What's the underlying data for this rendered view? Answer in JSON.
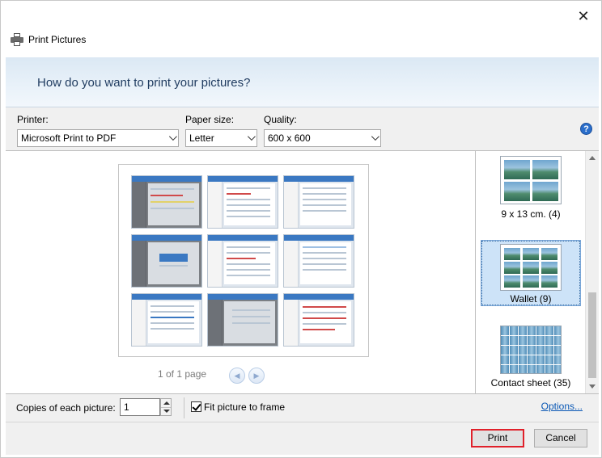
{
  "window": {
    "title": "Print Pictures",
    "close_symbol": "✕"
  },
  "banner": {
    "heading": "How do you want to print your pictures?"
  },
  "options": {
    "printer_label": "Printer:",
    "printer_value": "Microsoft Print to PDF",
    "paper_label": "Paper size:",
    "paper_value": "Letter",
    "quality_label": "Quality:",
    "quality_value": "600 x 600",
    "help_symbol": "?"
  },
  "preview": {
    "page_info": "1 of 1 page",
    "prev_symbol": "◀",
    "next_symbol": "▶"
  },
  "layouts": {
    "items": [
      {
        "label": "9 x 13 cm. (4)",
        "selected": false
      },
      {
        "label": "Wallet (9)",
        "selected": true
      },
      {
        "label": "Contact sheet (35)",
        "selected": false
      }
    ]
  },
  "bottom": {
    "copies_label": "Copies of each picture:",
    "copies_value": "1",
    "fit_label": "Fit picture to frame",
    "fit_checked": true,
    "options_link": "Options..."
  },
  "footer": {
    "print_label": "Print",
    "cancel_label": "Cancel"
  },
  "colors": {
    "accent_blue": "#0a58b5",
    "print_highlight": "#e0202a",
    "selection_bg": "#cde3f8"
  }
}
